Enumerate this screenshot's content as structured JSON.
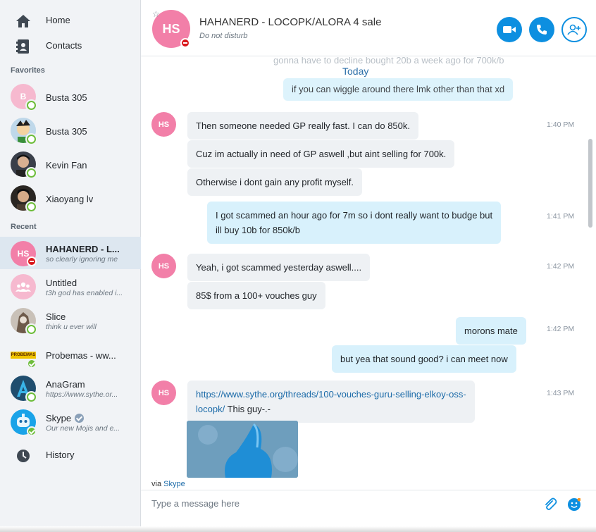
{
  "sidebar": {
    "nav": {
      "home": "Home",
      "contacts": "Contacts",
      "history": "History"
    },
    "favorites_label": "Favorites",
    "recent_label": "Recent",
    "favorites": [
      {
        "name": "Busta 305",
        "initial": "B"
      },
      {
        "name": "Busta 305"
      },
      {
        "name": "Kevin Fan"
      },
      {
        "name": "Xiaoyang lv"
      }
    ],
    "recent": [
      {
        "name": "HAHANERD - L...",
        "sub": "so clearly ignoring me",
        "initials": "HS"
      },
      {
        "name": "Untitled",
        "sub": "t3h god has enabled i..."
      },
      {
        "name": "Slice",
        "sub": "think u ever will"
      },
      {
        "name": "Probemas - ww...",
        "logo_text": "PROBEMAS"
      },
      {
        "name": "AnaGram",
        "sub": "https://www.sythe.or..."
      },
      {
        "name": "Skype",
        "sub": "Our new Mojis and e..."
      }
    ]
  },
  "header": {
    "avatar_initials": "HS",
    "title": "HAHANERD - LOCOPK/ALORA 4 sale",
    "status": "Do not disturb"
  },
  "conversation": {
    "faded_lines": [
      "gonna have to decline bought 20b a week ago for 700k/b",
      "if you can wiggle around there lmk other than that xd"
    ],
    "today_label": "Today",
    "sender_initials": "HS",
    "messages": [
      {
        "text": "Then someone needed GP really fast. I can do 850k.",
        "time": "1:40 PM"
      },
      {
        "text": "Cuz im actually in need of GP aswell ,but aint selling for 700k."
      },
      {
        "text": "Otherwise i dont gain any profit myself."
      },
      {
        "line1": "I got scammed an hour ago for 7m so i dont really want to budge but",
        "line2": "ill buy 10b for 850k/b",
        "time": "1:41 PM"
      },
      {
        "text": "Yeah, i got scammed yesterday aswell....",
        "time": "1:42 PM"
      },
      {
        "text": "85$ from a 100+ vouches guy"
      },
      {
        "text": "morons mate",
        "time": "1:42 PM"
      },
      {
        "text": "but yea that sound good? i can meet now"
      },
      {
        "link_line1": "https://www.sythe.org/threads/100-vouches-guru-selling-elkoy-oss-",
        "link_line2": "locopk/",
        "after": " This guy-.-",
        "time": "1:43 PM"
      }
    ]
  },
  "composer": {
    "via_prefix": "via ",
    "via_brand": "Skype",
    "placeholder": "Type a message here"
  },
  "colors": {
    "accent": "#0d8fe0",
    "avatar_pink": "#f27fa8",
    "incoming_bubble": "#eef1f4",
    "outgoing_bubble": "#d8f1fc",
    "online": "#6dbd3a",
    "dnd": "#d9161b"
  },
  "icons": [
    "home-icon",
    "contacts-icon",
    "history-icon",
    "video-call-icon",
    "audio-call-icon",
    "add-people-icon",
    "attach-icon",
    "emoji-icon",
    "favorite-star-icon"
  ]
}
